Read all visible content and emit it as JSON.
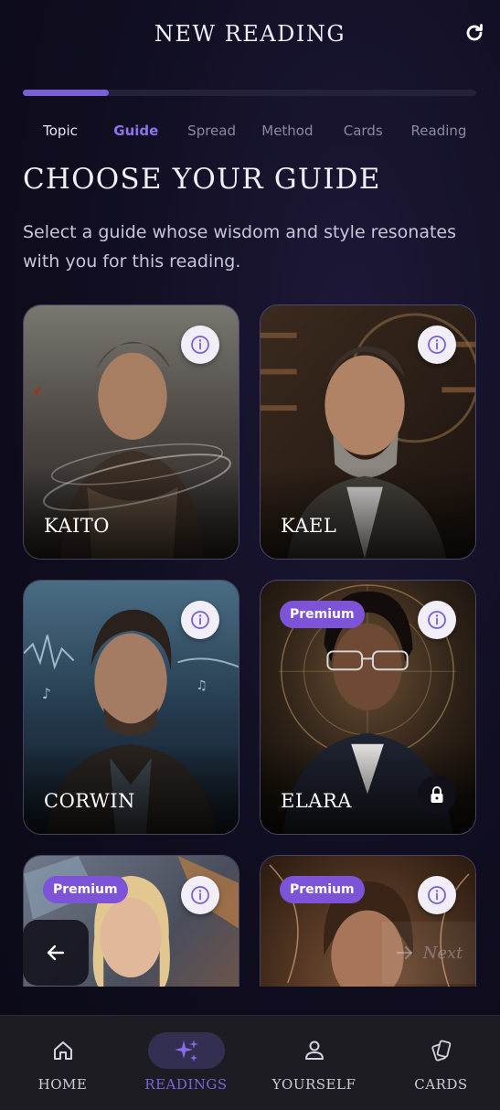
{
  "header": {
    "title": "NEW READING",
    "refresh_icon": "refresh-icon"
  },
  "progress": {
    "fraction": 0.19,
    "color": "#7a5fd6"
  },
  "steps": [
    {
      "label": "Topic",
      "state": "done"
    },
    {
      "label": "Guide",
      "state": "active"
    },
    {
      "label": "Spread",
      "state": "pending"
    },
    {
      "label": "Method",
      "state": "pending"
    },
    {
      "label": "Cards",
      "state": "pending"
    },
    {
      "label": "Reading",
      "state": "pending"
    }
  ],
  "main": {
    "title": "CHOOSE YOUR GUIDE",
    "subtitle": "Select a guide whose wisdom and style resonates with you for this reading."
  },
  "guides": [
    {
      "name": "KAITO",
      "premium": false,
      "locked": false
    },
    {
      "name": "KAEL",
      "premium": false,
      "locked": false
    },
    {
      "name": "CORWIN",
      "premium": false,
      "locked": false
    },
    {
      "name": "ELARA",
      "premium": true,
      "locked": true
    },
    {
      "name": "",
      "premium": true,
      "locked": false
    },
    {
      "name": "",
      "premium": true,
      "locked": false
    }
  ],
  "labels": {
    "premium": "Premium",
    "next": "Next"
  },
  "nav": [
    {
      "label": "HOME",
      "icon": "home-icon",
      "active": false
    },
    {
      "label": "READINGS",
      "icon": "sparkles-icon",
      "active": true
    },
    {
      "label": "YOURSELF",
      "icon": "person-icon",
      "active": false
    },
    {
      "label": "CARDS",
      "icon": "cards-icon",
      "active": false
    }
  ],
  "colors": {
    "accent": "#7a5fd6",
    "premium": "#7d53d8",
    "background": "#0f0d1f"
  }
}
